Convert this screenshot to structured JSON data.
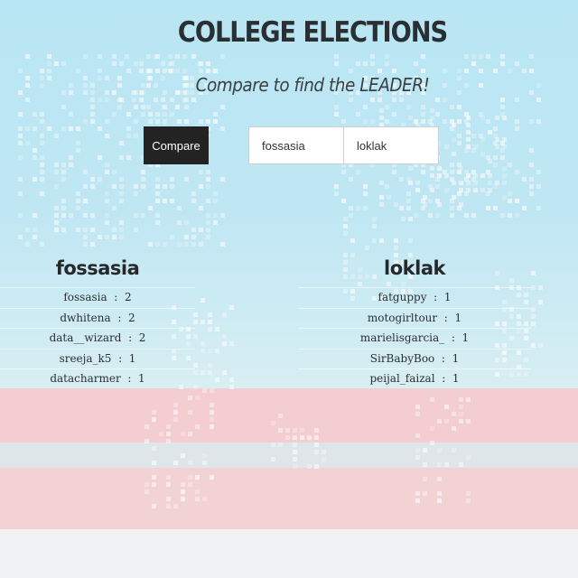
{
  "header": {
    "title": "COLLEGE ELECTIONS",
    "subtitle": "Compare to find the LEADER!"
  },
  "form": {
    "compare_label": "Compare",
    "input1_value": "fossasia",
    "input2_value": "loklak"
  },
  "results": {
    "left": {
      "title": "fossasia",
      "rows": [
        {
          "name": "fossasia",
          "sep": ":",
          "count": "2"
        },
        {
          "name": "dwhitena",
          "sep": ":",
          "count": "2"
        },
        {
          "name": "data__wizard",
          "sep": ":",
          "count": "2"
        },
        {
          "name": "sreeja_k5",
          "sep": ":",
          "count": "1"
        },
        {
          "name": "datacharmer",
          "sep": ":",
          "count": "1"
        }
      ]
    },
    "right": {
      "title": "loklak",
      "rows": [
        {
          "name": "fatguppy",
          "sep": ":",
          "count": "1"
        },
        {
          "name": "motogirltour",
          "sep": ":",
          "count": "1"
        },
        {
          "name": "marielisgarcia_",
          "sep": ":",
          "count": "1"
        },
        {
          "name": "SirBabyBoo",
          "sep": ":",
          "count": "1"
        },
        {
          "name": "peijal_faizal",
          "sep": ":",
          "count": "1"
        }
      ]
    }
  },
  "colors": {
    "button_bg": "#232323",
    "sky": "#b9e6f4",
    "pink_band": "#f4cdd0"
  }
}
